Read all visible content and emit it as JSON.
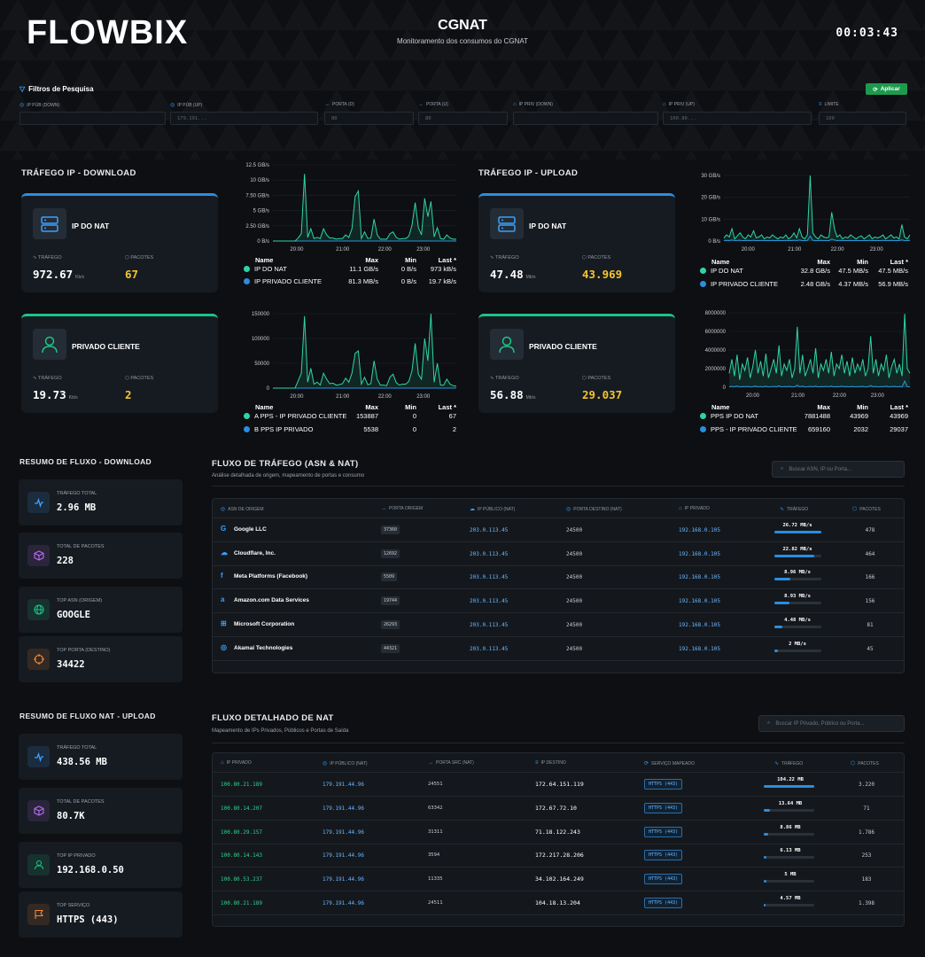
{
  "header": {
    "logo": "FLOWBIX",
    "title": "CGNAT",
    "subtitle": "Monitoramento dos consumos do CGNAT",
    "clock": "00:03:43"
  },
  "filters": {
    "title": "Filtros de Pesquisa",
    "apply_label": "Aplicar",
    "fields": [
      {
        "label": "IP PÚB (DOWN)",
        "placeholder": ""
      },
      {
        "label": "IP PÚB (UP)",
        "placeholder": "179.191..."
      },
      {
        "label": "PORTA (D)",
        "placeholder": "80"
      },
      {
        "label": "PORTA (U)",
        "placeholder": "80"
      },
      {
        "label": "IP PRIV (DOWN)",
        "placeholder": ""
      },
      {
        "label": "IP PRIV (UP)",
        "placeholder": "100.80..."
      },
      {
        "label": "LIMITE",
        "placeholder": "100"
      }
    ]
  },
  "download": {
    "section_title": "TRÁFEGO IP - DOWNLOAD",
    "cards": [
      {
        "name": "IP DO NAT",
        "traffic_label": "TRÁFEGO",
        "traffic": "972.67",
        "unit": "Kb/s",
        "packets_label": "PACOTES",
        "packets": "67"
      },
      {
        "name": "PRIVADO CLIENTE",
        "traffic_label": "TRÁFEGO",
        "traffic": "19.73",
        "unit": "Kb/s",
        "packets_label": "PACOTES",
        "packets": "2"
      }
    ]
  },
  "upload": {
    "section_title": "TRÁFEGO IP - UPLOAD",
    "cards": [
      {
        "name": "IP DO NAT",
        "traffic_label": "TRÁFEGO",
        "traffic": "47.48",
        "unit": "Mb/s",
        "packets_label": "PACOTES",
        "packets": "43.969"
      },
      {
        "name": "PRIVADO CLIENTE",
        "traffic_label": "TRÁFEGO",
        "traffic": "56.88",
        "unit": "Mb/s",
        "packets_label": "PACOTES",
        "packets": "29.037"
      }
    ]
  },
  "legend_headers": {
    "name": "Name",
    "max": "Max",
    "min": "Min",
    "last": "Last *"
  },
  "chart_data": [
    {
      "type": "line",
      "id": "dl_bytes",
      "y_ticks": [
        "0 B/s",
        "2.50 GB/s",
        "5 GB/s",
        "7.50 GB/s",
        "10 GB/s",
        "12.5 GB/s"
      ],
      "ylim": [
        0,
        12.5
      ],
      "x_ticks": [
        "20:00",
        "21:00",
        "22:00",
        "23:00"
      ],
      "series": [
        {
          "name": "IP DO NAT",
          "color": "#2ed4a8",
          "max": "11.1 GB/s",
          "min": "0 B/s",
          "last": "973 kB/s",
          "values": [
            0,
            0,
            0,
            0,
            0,
            0,
            0,
            0,
            0.5,
            1.2,
            11,
            0.6,
            2,
            0.4,
            0.6,
            0.4,
            2,
            1,
            0.5,
            0.5,
            0.3,
            0.4,
            0.4,
            1,
            0.6,
            2,
            7.3,
            8.2,
            0.4,
            1.5,
            0.4,
            0.5,
            3.6,
            1,
            0.3,
            0.3,
            0.3,
            1.2,
            1.5,
            0.6,
            0.3,
            0.4,
            0.4,
            0.8,
            2.6,
            6.3,
            2.2,
            1,
            7,
            4,
            6.5,
            0.7,
            2.2,
            0.4,
            0.3,
            1,
            0.5,
            0.3,
            0.3
          ]
        },
        {
          "name": "IP PRIVADO CLIENTE",
          "color": "#2b8de0",
          "max": "81.3 MB/s",
          "min": "0 B/s",
          "last": "19.7 kB/s",
          "values": [
            0,
            0,
            0,
            0,
            0,
            0,
            0,
            0,
            0,
            0,
            0,
            0,
            0,
            0,
            0,
            0,
            0,
            0,
            0,
            0,
            0,
            0,
            0,
            0,
            0,
            0,
            0,
            0,
            0,
            0,
            0,
            0,
            0,
            0,
            0,
            0,
            0,
            0,
            0,
            0,
            0,
            0,
            0,
            0,
            0,
            0,
            0,
            0,
            0,
            0,
            0,
            0,
            0,
            0,
            0,
            0,
            0,
            0,
            0
          ]
        }
      ]
    },
    {
      "type": "line",
      "id": "dl_packets",
      "y_ticks": [
        "0",
        "50000",
        "100000",
        "150000"
      ],
      "ylim": [
        0,
        150000
      ],
      "x_ticks": [
        "20:00",
        "21:00",
        "22:00",
        "23:00"
      ],
      "series": [
        {
          "name": "A PPS - IP PRIVADO CLIENTE",
          "color": "#2ed4a8",
          "max": "153887",
          "min": "0",
          "last": "67",
          "values": [
            0,
            0,
            0,
            0,
            0,
            0,
            0,
            0,
            15000,
            30000,
            145000,
            12000,
            40000,
            8000,
            12000,
            6000,
            30000,
            18000,
            9000,
            10000,
            6000,
            7000,
            9000,
            20000,
            12000,
            30000,
            70000,
            75000,
            8000,
            22000,
            7000,
            9000,
            55000,
            18000,
            6000,
            6000,
            5000,
            22000,
            28000,
            11000,
            6000,
            8000,
            8000,
            14000,
            35000,
            90000,
            28000,
            18000,
            100000,
            55000,
            153887,
            12000,
            50000,
            6000,
            6000,
            18000,
            8000,
            5000,
            4000
          ]
        },
        {
          "name": "B PPS IP PRIVADO",
          "color": "#2b8de0",
          "max": "5538",
          "min": "0",
          "last": "2",
          "values": [
            0,
            0,
            0,
            0,
            0,
            0,
            0,
            0,
            0,
            0,
            0,
            0,
            0,
            0,
            0,
            0,
            0,
            0,
            0,
            0,
            0,
            0,
            0,
            0,
            0,
            0,
            0,
            0,
            0,
            0,
            0,
            0,
            0,
            0,
            0,
            0,
            0,
            0,
            0,
            0,
            0,
            0,
            0,
            0,
            0,
            0,
            0,
            0,
            0,
            0,
            0,
            0,
            0,
            0,
            0,
            0,
            0,
            0,
            0
          ]
        }
      ]
    },
    {
      "type": "line",
      "id": "ul_bytes",
      "y_ticks": [
        "0 B/s",
        "10 GB/s",
        "20 GB/s",
        "30 GB/s"
      ],
      "ylim": [
        0,
        32
      ],
      "x_ticks": [
        "20:00",
        "21:00",
        "22:00",
        "23:00"
      ],
      "series": [
        {
          "name": "IP DO NAT",
          "color": "#2ed4a8",
          "max": "32.8 GB/s",
          "min": "47.5 MB/s",
          "last": "47.5 MB/s",
          "values": [
            1.5,
            3,
            2,
            6,
            1,
            2.5,
            4,
            2,
            1,
            3,
            2,
            5,
            1.5,
            2,
            3,
            1,
            2,
            1.5,
            3,
            2,
            1,
            2,
            1.5,
            3,
            1,
            2,
            4,
            1.5,
            6,
            2,
            1,
            3,
            32.8,
            4,
            2,
            1,
            3,
            2,
            1.5,
            2,
            14,
            6,
            2,
            3,
            1,
            2,
            1.5,
            3,
            2,
            1,
            2,
            2.5,
            1,
            2,
            3,
            1,
            2,
            1.5,
            2,
            3,
            1,
            2,
            3,
            1.5,
            2,
            1,
            8,
            2,
            1,
            3
          ]
        },
        {
          "name": "IP PRIVADO CLIENTE",
          "color": "#2b8de0",
          "max": "2.48 GB/s",
          "min": "4.37 MB/s",
          "last": "56.9 MB/s",
          "values": [
            0.2,
            0.3,
            0.2,
            0.5,
            0.2,
            0.3,
            0.4,
            0.2,
            0.2,
            0.3,
            0.2,
            0.4,
            0.2,
            0.2,
            0.3,
            0.2,
            0.2,
            0.2,
            0.3,
            0.2,
            0.2,
            0.2,
            0.2,
            0.3,
            0.2,
            0.2,
            0.4,
            0.2,
            0.5,
            0.2,
            0.2,
            0.3,
            2.48,
            0.4,
            0.2,
            0.2,
            0.3,
            0.2,
            0.2,
            0.2,
            1,
            0.5,
            0.2,
            0.3,
            0.2,
            0.2,
            0.2,
            0.3,
            0.2,
            0.2,
            0.2,
            0.2,
            0.2,
            0.2,
            0.3,
            0.2,
            0.2,
            0.2,
            0.2,
            0.3,
            0.2,
            0.2,
            0.3,
            0.2,
            0.2,
            0.2,
            0.6,
            0.2,
            0.2,
            0.3
          ]
        }
      ]
    },
    {
      "type": "line",
      "id": "ul_packets",
      "y_ticks": [
        "0",
        "2000000",
        "4000000",
        "6000000",
        "8000000"
      ],
      "ylim": [
        0,
        8000000
      ],
      "x_ticks": [
        "20:00",
        "21:00",
        "22:00",
        "23:00"
      ],
      "series": [
        {
          "name": "PPS IP DO NAT",
          "color": "#2ed4a8",
          "max": "7881488",
          "min": "43969",
          "last": "43969",
          "values": [
            1500000,
            3000000,
            1200000,
            3500000,
            800000,
            2500000,
            1800000,
            3200000,
            1000000,
            2200000,
            4000000,
            1500000,
            2800000,
            1200000,
            3600000,
            1000000,
            2000000,
            3000000,
            1500000,
            4500000,
            1200000,
            2500000,
            1800000,
            3000000,
            1000000,
            2000000,
            6500000,
            1500000,
            3500000,
            1200000,
            2000000,
            3000000,
            1500000,
            4200000,
            1000000,
            2500000,
            1800000,
            3000000,
            1500000,
            3800000,
            1200000,
            2500000,
            2000000,
            3500000,
            1500000,
            2800000,
            1200000,
            3200000,
            1500000,
            2500000,
            1800000,
            3000000,
            1200000,
            2000000,
            5500000,
            1500000,
            3000000,
            1200000,
            2500000,
            1800000,
            3500000,
            1000000,
            2200000,
            3000000,
            1500000,
            2500000,
            1200000,
            7881488,
            2000000,
            1500000
          ]
        },
        {
          "name": "PPS - IP PRIVADO CLIENTE",
          "color": "#2b8de0",
          "max": "659160",
          "min": "2032",
          "last": "29037",
          "values": [
            50000,
            100000,
            50000,
            120000,
            40000,
            80000,
            60000,
            100000,
            40000,
            70000,
            130000,
            50000,
            90000,
            40000,
            110000,
            40000,
            60000,
            100000,
            50000,
            150000,
            40000,
            80000,
            60000,
            100000,
            40000,
            60000,
            220000,
            50000,
            110000,
            40000,
            60000,
            100000,
            50000,
            130000,
            40000,
            80000,
            60000,
            100000,
            50000,
            120000,
            40000,
            80000,
            60000,
            110000,
            50000,
            90000,
            40000,
            100000,
            50000,
            80000,
            60000,
            100000,
            40000,
            60000,
            180000,
            50000,
            100000,
            40000,
            80000,
            60000,
            110000,
            40000,
            70000,
            100000,
            50000,
            80000,
            40000,
            659160,
            60000,
            50000
          ]
        }
      ]
    }
  ],
  "resumo_download": {
    "title": "RESUMO DE FLUXO - DOWNLOAD",
    "cards": [
      {
        "label": "TRÁFEGO TOTAL",
        "value": "2.96 MB",
        "icon": "activity-icon",
        "color": "#3aa0ff"
      },
      {
        "label": "TOTAL DE PACOTES",
        "value": "228",
        "icon": "cube-icon",
        "color": "#b36cf0"
      },
      {
        "label": "TOP ASN (ORIGEM)",
        "value": "GOOGLE",
        "icon": "globe-icon",
        "color": "#1cc486"
      },
      {
        "label": "TOP PORTA (DESTINO)",
        "value": "34422",
        "icon": "crosshair-icon",
        "color": "#f08a3a"
      }
    ]
  },
  "resumo_upload": {
    "title": "RESUMO DE FLUXO NAT - UPLOAD",
    "cards": [
      {
        "label": "TRÁFEGO TOTAL",
        "value": "438.56 MB",
        "icon": "activity-icon",
        "color": "#3aa0ff"
      },
      {
        "label": "TOTAL DE PACOTES",
        "value": "80.7K",
        "icon": "cube-icon",
        "color": "#b36cf0"
      },
      {
        "label": "TOP IP PRIVADO",
        "value": "192.168.0.50",
        "icon": "user-icon",
        "color": "#1cc486"
      },
      {
        "label": "TOP SERVIÇO",
        "value": "HTTPS (443)",
        "icon": "flag-icon",
        "color": "#f08a3a"
      }
    ]
  },
  "asn_table": {
    "title": "FLUXO DE TRÁFEGO (ASN & NAT)",
    "subtitle": "Análise detalhada de origem, mapeamento de portas e consumo",
    "search_placeholder": "Buscar ASN, IP ou Porta...",
    "headers": [
      "ASN DE ORIGEM",
      "PORTA ORIGEM",
      "IP PÚBLICO (NAT)",
      "PORTA DESTINO (NAT)",
      "IP PRIVADO",
      "TRÁFEGO",
      "PACOTES"
    ],
    "rows": [
      {
        "asn": "Google LLC",
        "icon": "google-icon",
        "porta_origem": "37360",
        "ip_publico": "203.0.113.45",
        "porta_destino": "24500",
        "ip_privado": "192.168.0.105",
        "trafego": "26.72 MB/s",
        "fill": 1.0,
        "pacotes": "478"
      },
      {
        "asn": "Cloudflare, Inc.",
        "icon": "cloud-icon",
        "porta_origem": "12692",
        "ip_publico": "203.0.113.45",
        "porta_destino": "24500",
        "ip_privado": "192.168.0.105",
        "trafego": "22.82 MB/s",
        "fill": 0.85,
        "pacotes": "464"
      },
      {
        "asn": "Meta Platforms (Facebook)",
        "icon": "facebook-icon",
        "porta_origem": "5509",
        "ip_publico": "203.0.113.45",
        "porta_destino": "24500",
        "ip_privado": "192.168.0.105",
        "trafego": "8.96 MB/s",
        "fill": 0.34,
        "pacotes": "166"
      },
      {
        "asn": "Amazon.com Data Services",
        "icon": "amazon-icon",
        "porta_origem": "19744",
        "ip_publico": "203.0.113.45",
        "porta_destino": "24500",
        "ip_privado": "192.168.0.105",
        "trafego": "8.93 MB/s",
        "fill": 0.33,
        "pacotes": "156"
      },
      {
        "asn": "Microsoft Corporation",
        "icon": "windows-icon",
        "porta_origem": "26293",
        "ip_publico": "203.0.113.45",
        "porta_destino": "24500",
        "ip_privado": "192.168.0.105",
        "trafego": "4.48 MB/s",
        "fill": 0.17,
        "pacotes": "81"
      },
      {
        "asn": "Akamai Technologies",
        "icon": "globe-icon",
        "porta_origem": "44321",
        "ip_publico": "203.0.113.45",
        "porta_destino": "24500",
        "ip_privado": "192.168.0.105",
        "trafego": "2 MB/s",
        "fill": 0.07,
        "pacotes": "45"
      }
    ]
  },
  "nat_table": {
    "title": "FLUXO DETALHADO DE NAT",
    "subtitle": "Mapeamento de IPs Privados, Públicos e Portas de Saída",
    "search_placeholder": "Buscar IP Privado, Público ou Porta...",
    "headers": [
      "IP PRIVADO",
      "IP PÚBLICO (NAT)",
      "PORTA SRC (NAT)",
      "IP DESTINO",
      "SERVIÇO MAPEADO",
      "TRÁFEGO",
      "PACOTES"
    ],
    "rows": [
      {
        "ip_privado": "100.80.21.189",
        "ip_publico": "179.191.44.96",
        "porta_src": "24551",
        "ip_destino": "172.64.151.119",
        "servico": "HTTPS (443)",
        "trafego": "104.22 MB",
        "fill": 1.0,
        "pacotes": "3.220"
      },
      {
        "ip_privado": "100.80.14.207",
        "ip_publico": "179.191.44.96",
        "porta_src": "63342",
        "ip_destino": "172.67.72.10",
        "servico": "HTTPS (443)",
        "trafego": "13.64 MB",
        "fill": 0.13,
        "pacotes": "71"
      },
      {
        "ip_privado": "100.80.29.157",
        "ip_publico": "179.191.44.96",
        "porta_src": "31311",
        "ip_destino": "71.18.122.243",
        "servico": "HTTPS (443)",
        "trafego": "8.86 MB",
        "fill": 0.09,
        "pacotes": "1.786"
      },
      {
        "ip_privado": "100.80.14.143",
        "ip_publico": "179.191.44.96",
        "porta_src": "3594",
        "ip_destino": "172.217.28.206",
        "servico": "HTTPS (443)",
        "trafego": "6.13 MB",
        "fill": 0.06,
        "pacotes": "253"
      },
      {
        "ip_privado": "100.80.53.237",
        "ip_publico": "179.191.44.96",
        "porta_src": "11335",
        "ip_destino": "34.102.164.249",
        "servico": "HTTPS (443)",
        "trafego": "5 MB",
        "fill": 0.05,
        "pacotes": "183"
      },
      {
        "ip_privado": "100.80.21.189",
        "ip_publico": "179.191.44.96",
        "porta_src": "24511",
        "ip_destino": "104.18.13.204",
        "servico": "HTTPS (443)",
        "trafego": "4.57 MB",
        "fill": 0.04,
        "pacotes": "1.398"
      }
    ]
  }
}
